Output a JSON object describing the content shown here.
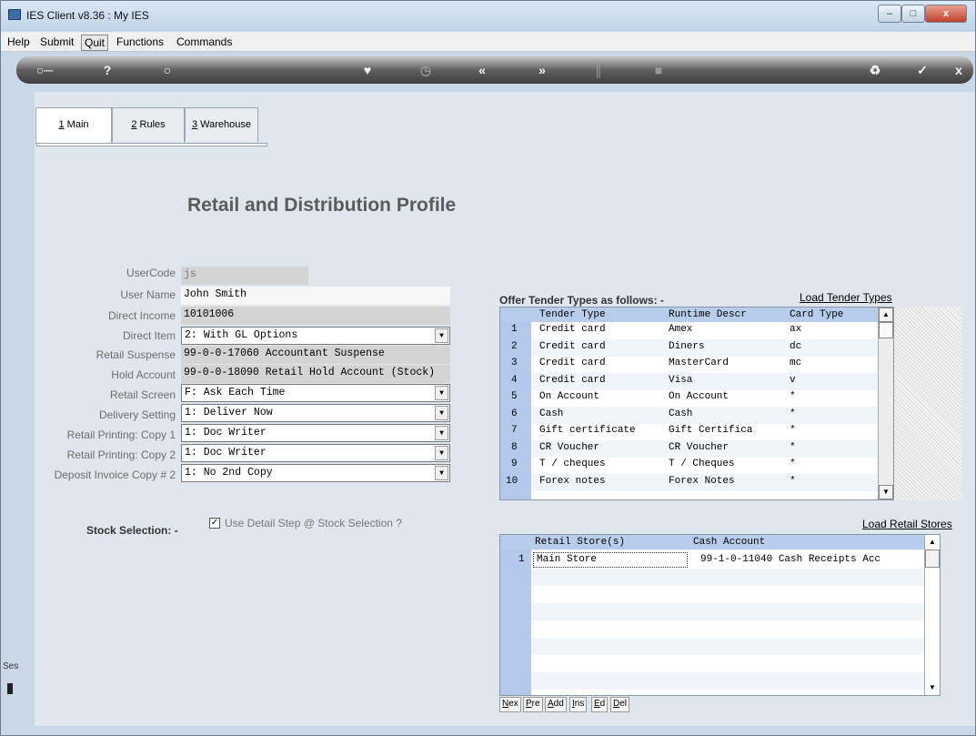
{
  "window": {
    "title": "IES Client v8.36 : My IES"
  },
  "menu": [
    "Help",
    "Submit",
    "Quit",
    "Functions",
    "Commands"
  ],
  "tabs": [
    {
      "key": "1",
      "rest": " Main"
    },
    {
      "key": "2",
      "rest": " Rules"
    },
    {
      "key": "3",
      "rest": " Warehouse"
    }
  ],
  "page_title": "Retail and Distribution Profile",
  "form": {
    "usercode": {
      "label": "UserCode",
      "value": "js"
    },
    "user_name": {
      "label": "User Name",
      "value": "John Smith"
    },
    "direct_income": {
      "label": "Direct Income",
      "value": "10101006"
    },
    "direct_item": {
      "label": "Direct Item",
      "value": "2: With GL Options"
    },
    "retail_suspense": {
      "label": "Retail Suspense",
      "value": "99-0-0-17060 Accountant Suspense"
    },
    "hold_account": {
      "label": "Hold Account",
      "value": "99-0-0-18090 Retail Hold Account (Stock)"
    },
    "retail_screen": {
      "label": "Retail Screen",
      "value": "F: Ask Each Time"
    },
    "delivery_setting": {
      "label": "Delivery Setting",
      "value": "1: Deliver Now"
    },
    "printing_copy1": {
      "label": "Retail Printing: Copy 1",
      "value": "1: Doc Writer"
    },
    "printing_copy2": {
      "label": "Retail Printing: Copy 2",
      "value": "1: Doc Writer"
    },
    "deposit_copy2": {
      "label": "Deposit Invoice Copy # 2",
      "value": "1: No 2nd Copy"
    }
  },
  "tender": {
    "label": "Offer Tender Types as follows: -",
    "load_link": "Load Tender Types",
    "columns": [
      "Tender Type",
      "Runtime Descr",
      "Card Type"
    ],
    "rows": [
      [
        "1",
        "Credit card",
        "Amex",
        "ax"
      ],
      [
        "2",
        "Credit card",
        "Diners",
        "dc"
      ],
      [
        "3",
        "Credit card",
        "MasterCard",
        "mc"
      ],
      [
        "4",
        "Credit card",
        "Visa",
        "v"
      ],
      [
        "5",
        "On Account",
        "On Account",
        "*"
      ],
      [
        "6",
        "Cash",
        "Cash",
        "*"
      ],
      [
        "7",
        "Gift certificate",
        "Gift Certifica",
        "*"
      ],
      [
        "8",
        "CR Voucher",
        "CR Voucher",
        "*"
      ],
      [
        "9",
        "T / cheques",
        "T / Cheques",
        "*"
      ],
      [
        "10",
        "Forex notes",
        "Forex Notes",
        "*"
      ]
    ]
  },
  "stock_selection": {
    "label": "Stock Selection: -",
    "checkbox_label": "Use Detail Step @ Stock Selection ?",
    "checked": true
  },
  "stores": {
    "load_link": "Load Retail Stores",
    "columns": [
      "Retail Store(s)",
      "Cash Account"
    ],
    "rows": [
      [
        "1",
        "Main Store",
        "99-1-0-11040 Cash Receipts Acc"
      ]
    ]
  },
  "nav_buttons": [
    {
      "key": "N",
      "rest": "ex"
    },
    {
      "key": "P",
      "rest": "re"
    },
    {
      "key": "A",
      "rest": "dd"
    },
    {
      "key": "I",
      "rest": "ns"
    },
    {
      "key": "E",
      "rest": "d"
    },
    {
      "key": "D",
      "rest": "el"
    }
  ],
  "side_label": "Ses",
  "colors": {
    "header": "#b8cdeb",
    "accent": "#3f6aa5"
  }
}
